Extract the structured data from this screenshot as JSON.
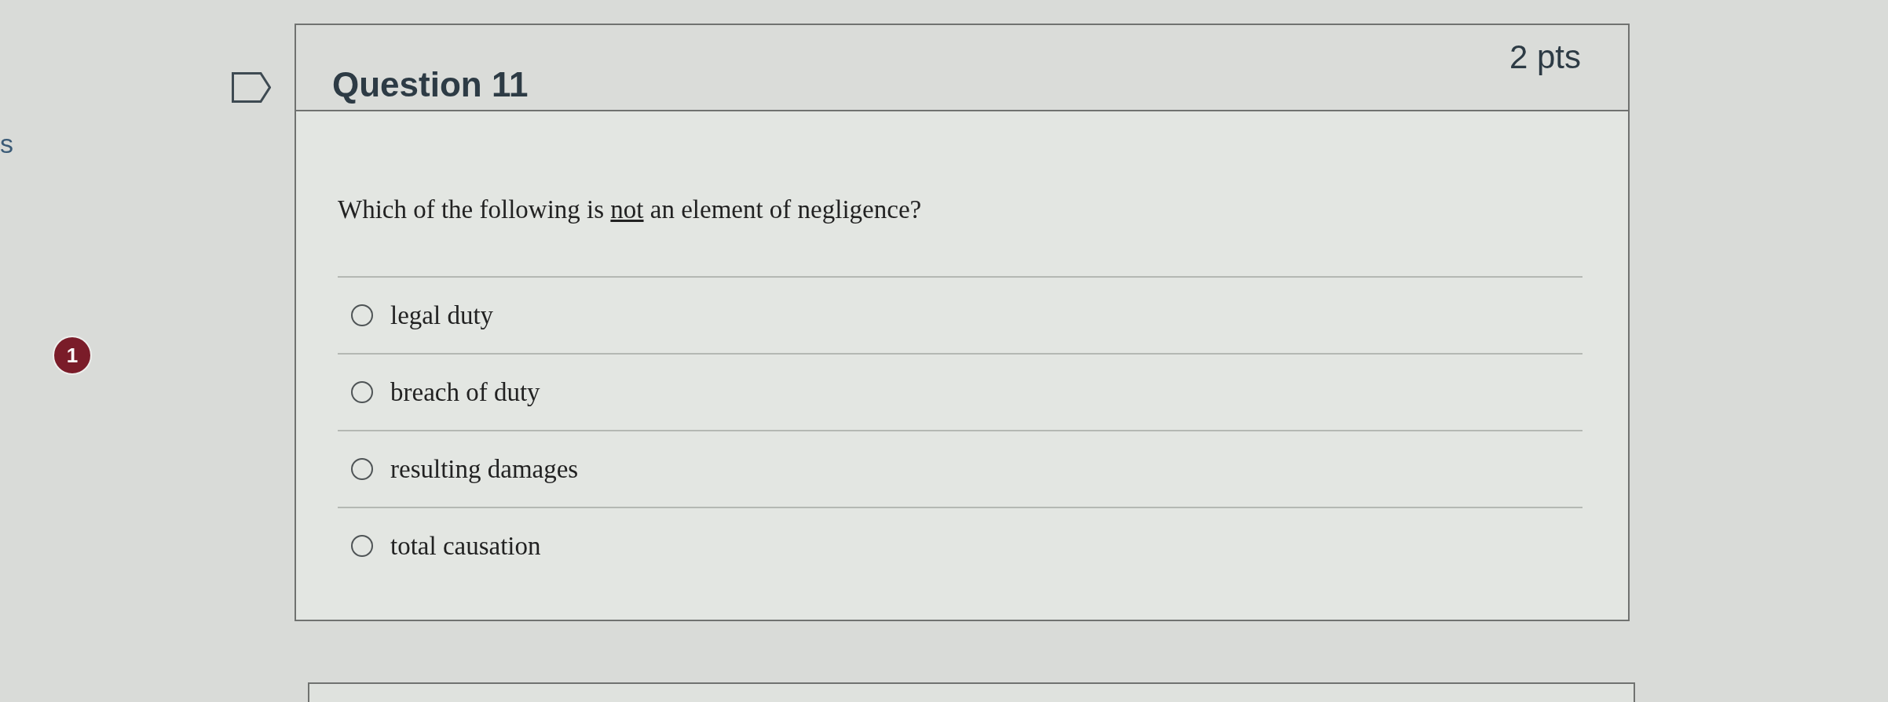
{
  "left_margin": {
    "text_fragment": "s",
    "badge": "1"
  },
  "question": {
    "flagged": false,
    "title": "Question 11",
    "points": "2 pts",
    "prompt": {
      "before": "Which of the following is ",
      "underlined": "not",
      "after": " an element of negligence?"
    },
    "answers": [
      {
        "label": "legal duty",
        "selected": false
      },
      {
        "label": "breach of duty",
        "selected": false
      },
      {
        "label": "resulting damages",
        "selected": false
      },
      {
        "label": "total causation",
        "selected": false
      }
    ]
  }
}
